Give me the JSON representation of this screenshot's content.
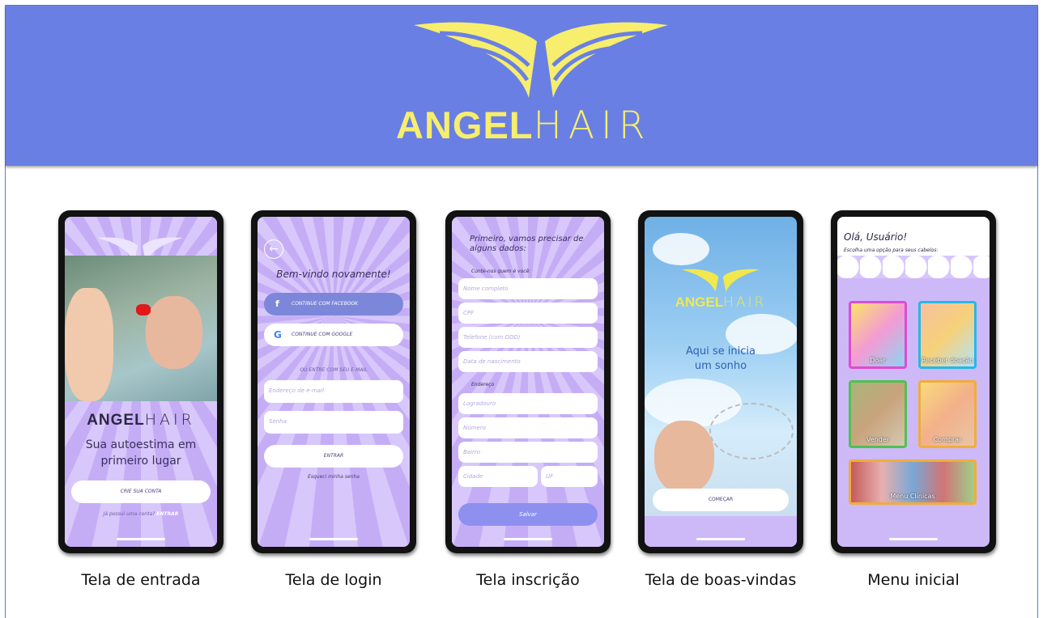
{
  "brand": {
    "logo_bold": "ANGEL",
    "logo_light": "HAIR"
  },
  "colors": {
    "banner": "#6a7fe4",
    "logo": "#f6ee6c",
    "screen": "#cdb9f8",
    "accent": "#8d90ef"
  },
  "captions": [
    "Tela de entrada",
    "Tela de login",
    "Tela inscrição",
    "Tela de boas-vindas",
    "Menu inicial"
  ],
  "entrada": {
    "logo_bold": "ANGEL",
    "logo_light": "HAIR",
    "tagline": "Sua autoestima em primeiro lugar",
    "create_account": "CRIE SUA CONTA",
    "have_account": "Já possui uma conta?",
    "enter_link": "ENTRAR"
  },
  "login": {
    "welcome": "Bem-vindo novamente!",
    "facebook": "CONTINUE COM FACEBOOK",
    "google": "CONTINUE COM GOOGLE",
    "or_email": "OU ENTRE COM SEU E-MAIL",
    "email_placeholder": "Endereço de e-mail",
    "password_placeholder": "Senha",
    "enter": "ENTRAR",
    "forgot": "Esqueci minha senha"
  },
  "inscricao": {
    "title": "Primeiro, vamos precisar de alguns dados:",
    "subtitle": "Conte-nos quem é você:",
    "fields": [
      "Nome completo",
      "CPF",
      "Telefone (com DDD)",
      "Data de nascimento"
    ],
    "address_label": "Endereço",
    "address_fields": [
      "Logradouro",
      "Número",
      "Bairro"
    ],
    "city": "Cidade",
    "uf": "UF",
    "save": "Salvar"
  },
  "boasvindas": {
    "logo_bold": "ANGEL",
    "logo_light": "HAIR",
    "message_line1": "Aqui se inicia",
    "message_line2": "um sonho",
    "start": "COMEÇAR"
  },
  "menu": {
    "greeting": "Olá, Usuário!",
    "prompt": "Escolha uma opção para seus cabelos:",
    "tiles": [
      "Doar",
      "Receber doação",
      "Vender",
      "Comprar",
      "Menu Clínicas"
    ]
  }
}
